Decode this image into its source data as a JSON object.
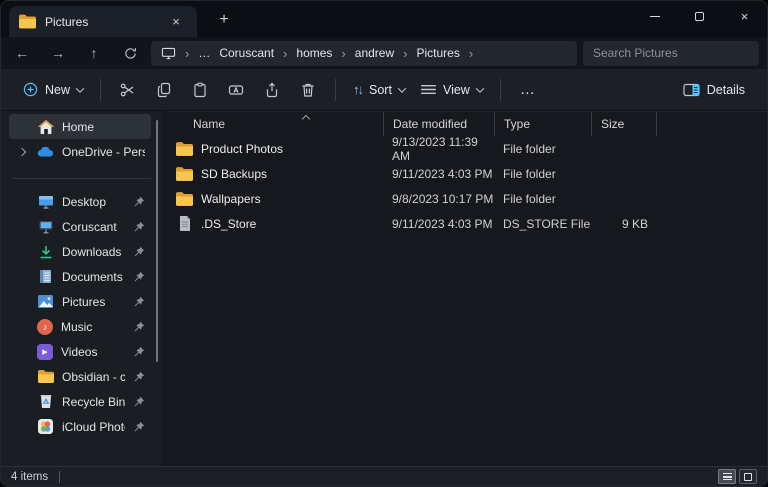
{
  "colors": {
    "accent": "#4cc2ff",
    "folder_front": "#f6c64e",
    "folder_back": "#e09f35",
    "selection_bg": "#2d3138"
  },
  "icons": {
    "back": "←",
    "forward": "→",
    "up": "↑",
    "breadcrumb_chevron": "›",
    "breadcrumb_overflow": "…",
    "more": "…",
    "tab_close": "×",
    "new_tab": "+",
    "window_close": "×",
    "sort_up": "↑",
    "sort_down": "↓",
    "music_note": "♪",
    "video_play": "▶",
    "status_separator": "|"
  },
  "tab_bar": {
    "active_tab_title": "Pictures"
  },
  "address_bar": {
    "breadcrumbs": [
      "Coruscant",
      "homes",
      "andrew",
      "Pictures"
    ],
    "search_placeholder": "Search Pictures"
  },
  "toolbar": {
    "new_label": "New",
    "sort_label": "Sort",
    "view_label": "View",
    "details_label": "Details"
  },
  "sidebar": {
    "home": {
      "label": "Home"
    },
    "onedrive": {
      "label": "OneDrive - Personal"
    },
    "pinned": [
      {
        "label": "Desktop"
      },
      {
        "label": "Coruscant"
      },
      {
        "label": "Downloads"
      },
      {
        "label": "Documents"
      },
      {
        "label": "Pictures"
      },
      {
        "label": "Music"
      },
      {
        "label": "Videos"
      },
      {
        "label": "Obsidian - chewie"
      },
      {
        "label": "Recycle Bin"
      },
      {
        "label": "iCloud Photos"
      }
    ]
  },
  "file_list": {
    "columns": [
      "Name",
      "Date modified",
      "Type",
      "Size"
    ],
    "rows": [
      {
        "name": "Product Photos",
        "date_modified": "9/13/2023 11:39 AM",
        "type": "File folder",
        "size": ""
      },
      {
        "name": "SD Backups",
        "date_modified": "9/11/2023 4:03 PM",
        "type": "File folder",
        "size": ""
      },
      {
        "name": "Wallpapers",
        "date_modified": "9/8/2023 10:17 PM",
        "type": "File folder",
        "size": ""
      },
      {
        "name": ".DS_Store",
        "date_modified": "9/11/2023 4:03 PM",
        "type": "DS_STORE File",
        "size": "9 KB"
      }
    ]
  },
  "status_bar": {
    "item_count": "4 items"
  }
}
